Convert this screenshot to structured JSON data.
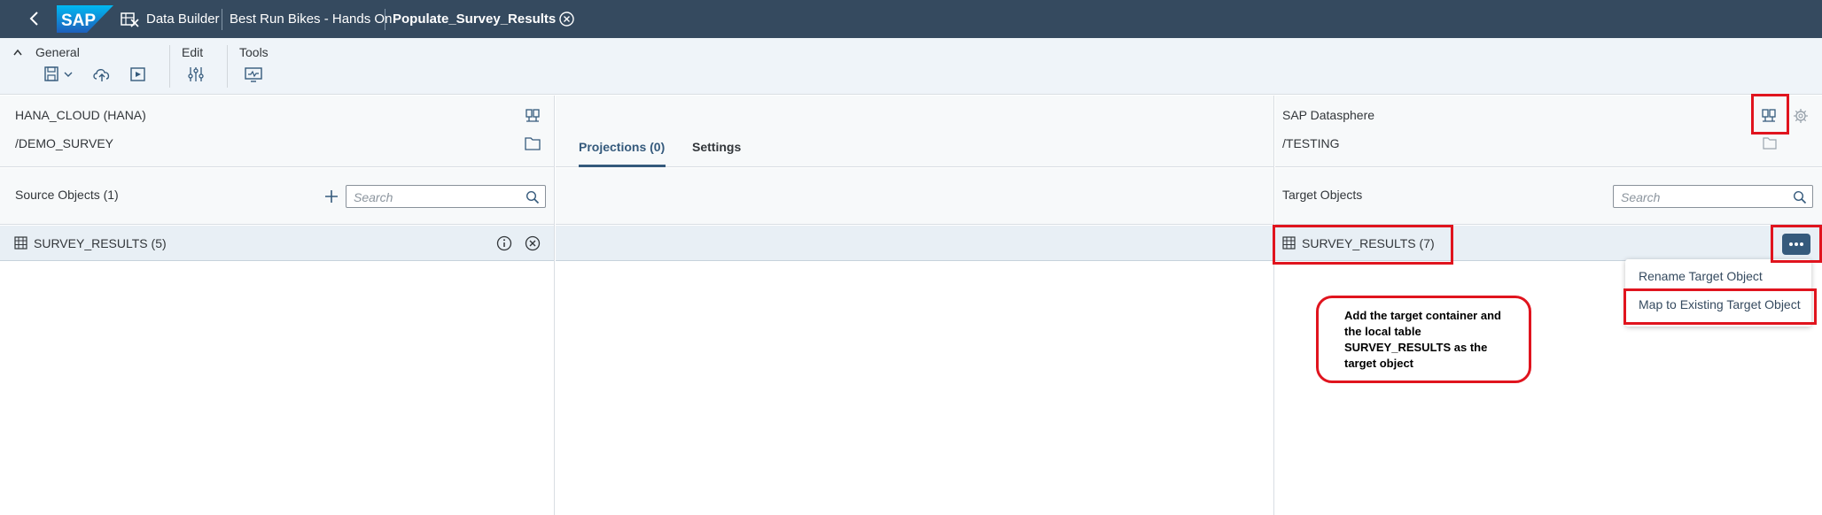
{
  "shell": {
    "logo_text": "SAP",
    "breadcrumbs": [
      {
        "label": "Data Builder"
      },
      {
        "label": "Best Run Bikes - Hands On"
      },
      {
        "label": "Populate_Survey_Results"
      }
    ]
  },
  "toolbar": {
    "groups": [
      {
        "label": "General",
        "icons": [
          "save-icon",
          "chevron-down-icon",
          "deploy-icon",
          "run-icon"
        ]
      },
      {
        "label": "Edit",
        "icons": [
          "settings-sliders-icon"
        ]
      },
      {
        "label": "Tools",
        "icons": [
          "monitor-icon"
        ]
      }
    ]
  },
  "source": {
    "connection": "HANA_CLOUD (HANA)",
    "container": "/DEMO_SURVEY",
    "objects_label": "Source Objects (1)",
    "search_placeholder": "Search",
    "object": "SURVEY_RESULTS (5)"
  },
  "middle": {
    "tabs": [
      {
        "label": "Projections (0)",
        "active": true
      },
      {
        "label": "Settings",
        "active": false
      }
    ]
  },
  "target": {
    "connection": "SAP Datasphere",
    "container": "/TESTING",
    "objects_label": "Target Objects",
    "search_placeholder": "Search",
    "object": "SURVEY_RESULTS (7)"
  },
  "menu": {
    "items": [
      {
        "label": "Rename Target Object"
      },
      {
        "label": "Map to Existing Target Object"
      }
    ]
  },
  "callout": {
    "text": "Add the target container and the local table SURVEY_RESULTS as the target object"
  },
  "colors": {
    "shell": "#354a5f",
    "accent": "#355a7c",
    "highlight": "#e0141e"
  }
}
